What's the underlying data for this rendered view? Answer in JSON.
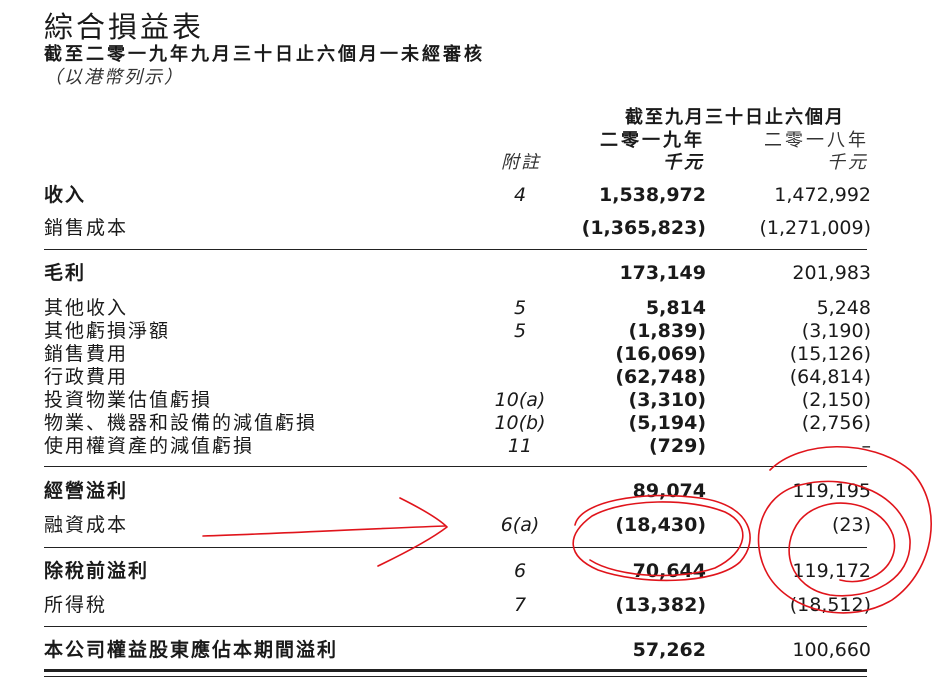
{
  "header": {
    "title": "綜合損益表",
    "subtitle": "截至二零一九年九月三十日止六個月一未經審核",
    "currency_note": "（以港幣列示）"
  },
  "columns": {
    "period": "截至九月三十日止六個月",
    "note_label": "附註",
    "current_year": "二零一九年",
    "prior_year": "二零一八年",
    "current_unit": "千元",
    "prior_unit": "千元"
  },
  "rows": [
    {
      "label": "收入",
      "note": "4",
      "current": "1,538,972",
      "prior": "1,472,992",
      "bold": true
    },
    {
      "label": "銷售成本",
      "note": "",
      "current": "(1,365,823)",
      "prior": "(1,271,009)",
      "bold": false
    },
    {
      "label": "毛利",
      "note": "",
      "current": "173,149",
      "prior": "201,983",
      "bold": true
    },
    {
      "label": "其他收入",
      "note": "5",
      "current": "5,814",
      "prior": "5,248",
      "bold": false
    },
    {
      "label": "其他虧損淨額",
      "note": "5",
      "current": "(1,839)",
      "prior": "(3,190)",
      "bold": false
    },
    {
      "label": "銷售費用",
      "note": "",
      "current": "(16,069)",
      "prior": "(15,126)",
      "bold": false
    },
    {
      "label": "行政費用",
      "note": "",
      "current": "(62,748)",
      "prior": "(64,814)",
      "bold": false
    },
    {
      "label": "投資物業估值虧損",
      "note": "10(a)",
      "current": "(3,310)",
      "prior": "(2,150)",
      "bold": false
    },
    {
      "label": "物業、機器和設備的減值虧損",
      "note": "10(b)",
      "current": "(5,194)",
      "prior": "(2,756)",
      "bold": false
    },
    {
      "label": "使用權資產的減值虧損",
      "note": "11",
      "current": "(729)",
      "prior": "–",
      "bold": false
    },
    {
      "label": "經營溢利",
      "note": "",
      "current": "89,074",
      "prior": "119,195",
      "bold": true
    },
    {
      "label": "融資成本",
      "note": "6(a)",
      "current": "(18,430)",
      "prior": "(23)",
      "bold": false
    },
    {
      "label": "除稅前溢利",
      "note": "6",
      "current": "70,644",
      "prior": "119,172",
      "bold": true
    },
    {
      "label": "所得稅",
      "note": "7",
      "current": "(13,382)",
      "prior": "(18,512)",
      "bold": false
    },
    {
      "label": "本公司權益股東應佔本期間溢利",
      "note": "",
      "current": "57,262",
      "prior": "100,660",
      "bold": true
    }
  ],
  "annotation": {
    "ink_color": "#e0141b"
  }
}
